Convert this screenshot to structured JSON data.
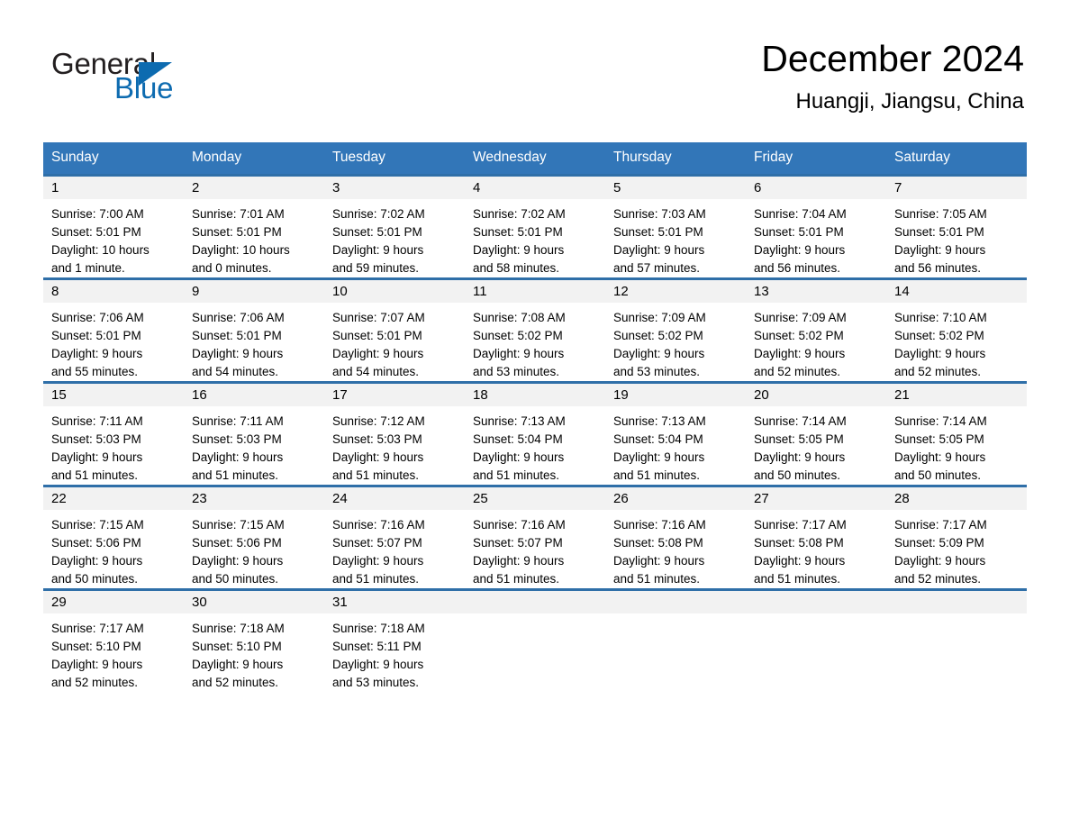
{
  "brand": {
    "name_part1": "General",
    "name_part2": "Blue",
    "triangle_color": "#0d6bb0"
  },
  "header": {
    "title": "December 2024",
    "location": "Huangji, Jiangsu, China"
  },
  "theme": {
    "header_blue": "#3276b8",
    "row_separator_blue": "#2f6fa8",
    "daynum_band_gray": "#f2f2f2"
  },
  "weekdays": [
    "Sunday",
    "Monday",
    "Tuesday",
    "Wednesday",
    "Thursday",
    "Friday",
    "Saturday"
  ],
  "weeks": [
    [
      {
        "day": "1",
        "sunrise": "Sunrise: 7:00 AM",
        "sunset": "Sunset: 5:01 PM",
        "daylight1": "Daylight: 10 hours",
        "daylight2": "and 1 minute."
      },
      {
        "day": "2",
        "sunrise": "Sunrise: 7:01 AM",
        "sunset": "Sunset: 5:01 PM",
        "daylight1": "Daylight: 10 hours",
        "daylight2": "and 0 minutes."
      },
      {
        "day": "3",
        "sunrise": "Sunrise: 7:02 AM",
        "sunset": "Sunset: 5:01 PM",
        "daylight1": "Daylight: 9 hours",
        "daylight2": "and 59 minutes."
      },
      {
        "day": "4",
        "sunrise": "Sunrise: 7:02 AM",
        "sunset": "Sunset: 5:01 PM",
        "daylight1": "Daylight: 9 hours",
        "daylight2": "and 58 minutes."
      },
      {
        "day": "5",
        "sunrise": "Sunrise: 7:03 AM",
        "sunset": "Sunset: 5:01 PM",
        "daylight1": "Daylight: 9 hours",
        "daylight2": "and 57 minutes."
      },
      {
        "day": "6",
        "sunrise": "Sunrise: 7:04 AM",
        "sunset": "Sunset: 5:01 PM",
        "daylight1": "Daylight: 9 hours",
        "daylight2": "and 56 minutes."
      },
      {
        "day": "7",
        "sunrise": "Sunrise: 7:05 AM",
        "sunset": "Sunset: 5:01 PM",
        "daylight1": "Daylight: 9 hours",
        "daylight2": "and 56 minutes."
      }
    ],
    [
      {
        "day": "8",
        "sunrise": "Sunrise: 7:06 AM",
        "sunset": "Sunset: 5:01 PM",
        "daylight1": "Daylight: 9 hours",
        "daylight2": "and 55 minutes."
      },
      {
        "day": "9",
        "sunrise": "Sunrise: 7:06 AM",
        "sunset": "Sunset: 5:01 PM",
        "daylight1": "Daylight: 9 hours",
        "daylight2": "and 54 minutes."
      },
      {
        "day": "10",
        "sunrise": "Sunrise: 7:07 AM",
        "sunset": "Sunset: 5:01 PM",
        "daylight1": "Daylight: 9 hours",
        "daylight2": "and 54 minutes."
      },
      {
        "day": "11",
        "sunrise": "Sunrise: 7:08 AM",
        "sunset": "Sunset: 5:02 PM",
        "daylight1": "Daylight: 9 hours",
        "daylight2": "and 53 minutes."
      },
      {
        "day": "12",
        "sunrise": "Sunrise: 7:09 AM",
        "sunset": "Sunset: 5:02 PM",
        "daylight1": "Daylight: 9 hours",
        "daylight2": "and 53 minutes."
      },
      {
        "day": "13",
        "sunrise": "Sunrise: 7:09 AM",
        "sunset": "Sunset: 5:02 PM",
        "daylight1": "Daylight: 9 hours",
        "daylight2": "and 52 minutes."
      },
      {
        "day": "14",
        "sunrise": "Sunrise: 7:10 AM",
        "sunset": "Sunset: 5:02 PM",
        "daylight1": "Daylight: 9 hours",
        "daylight2": "and 52 minutes."
      }
    ],
    [
      {
        "day": "15",
        "sunrise": "Sunrise: 7:11 AM",
        "sunset": "Sunset: 5:03 PM",
        "daylight1": "Daylight: 9 hours",
        "daylight2": "and 51 minutes."
      },
      {
        "day": "16",
        "sunrise": "Sunrise: 7:11 AM",
        "sunset": "Sunset: 5:03 PM",
        "daylight1": "Daylight: 9 hours",
        "daylight2": "and 51 minutes."
      },
      {
        "day": "17",
        "sunrise": "Sunrise: 7:12 AM",
        "sunset": "Sunset: 5:03 PM",
        "daylight1": "Daylight: 9 hours",
        "daylight2": "and 51 minutes."
      },
      {
        "day": "18",
        "sunrise": "Sunrise: 7:13 AM",
        "sunset": "Sunset: 5:04 PM",
        "daylight1": "Daylight: 9 hours",
        "daylight2": "and 51 minutes."
      },
      {
        "day": "19",
        "sunrise": "Sunrise: 7:13 AM",
        "sunset": "Sunset: 5:04 PM",
        "daylight1": "Daylight: 9 hours",
        "daylight2": "and 51 minutes."
      },
      {
        "day": "20",
        "sunrise": "Sunrise: 7:14 AM",
        "sunset": "Sunset: 5:05 PM",
        "daylight1": "Daylight: 9 hours",
        "daylight2": "and 50 minutes."
      },
      {
        "day": "21",
        "sunrise": "Sunrise: 7:14 AM",
        "sunset": "Sunset: 5:05 PM",
        "daylight1": "Daylight: 9 hours",
        "daylight2": "and 50 minutes."
      }
    ],
    [
      {
        "day": "22",
        "sunrise": "Sunrise: 7:15 AM",
        "sunset": "Sunset: 5:06 PM",
        "daylight1": "Daylight: 9 hours",
        "daylight2": "and 50 minutes."
      },
      {
        "day": "23",
        "sunrise": "Sunrise: 7:15 AM",
        "sunset": "Sunset: 5:06 PM",
        "daylight1": "Daylight: 9 hours",
        "daylight2": "and 50 minutes."
      },
      {
        "day": "24",
        "sunrise": "Sunrise: 7:16 AM",
        "sunset": "Sunset: 5:07 PM",
        "daylight1": "Daylight: 9 hours",
        "daylight2": "and 51 minutes."
      },
      {
        "day": "25",
        "sunrise": "Sunrise: 7:16 AM",
        "sunset": "Sunset: 5:07 PM",
        "daylight1": "Daylight: 9 hours",
        "daylight2": "and 51 minutes."
      },
      {
        "day": "26",
        "sunrise": "Sunrise: 7:16 AM",
        "sunset": "Sunset: 5:08 PM",
        "daylight1": "Daylight: 9 hours",
        "daylight2": "and 51 minutes."
      },
      {
        "day": "27",
        "sunrise": "Sunrise: 7:17 AM",
        "sunset": "Sunset: 5:08 PM",
        "daylight1": "Daylight: 9 hours",
        "daylight2": "and 51 minutes."
      },
      {
        "day": "28",
        "sunrise": "Sunrise: 7:17 AM",
        "sunset": "Sunset: 5:09 PM",
        "daylight1": "Daylight: 9 hours",
        "daylight2": "and 52 minutes."
      }
    ],
    [
      {
        "day": "29",
        "sunrise": "Sunrise: 7:17 AM",
        "sunset": "Sunset: 5:10 PM",
        "daylight1": "Daylight: 9 hours",
        "daylight2": "and 52 minutes."
      },
      {
        "day": "30",
        "sunrise": "Sunrise: 7:18 AM",
        "sunset": "Sunset: 5:10 PM",
        "daylight1": "Daylight: 9 hours",
        "daylight2": "and 52 minutes."
      },
      {
        "day": "31",
        "sunrise": "Sunrise: 7:18 AM",
        "sunset": "Sunset: 5:11 PM",
        "daylight1": "Daylight: 9 hours",
        "daylight2": "and 53 minutes."
      },
      {
        "day": "",
        "sunrise": "",
        "sunset": "",
        "daylight1": "",
        "daylight2": ""
      },
      {
        "day": "",
        "sunrise": "",
        "sunset": "",
        "daylight1": "",
        "daylight2": ""
      },
      {
        "day": "",
        "sunrise": "",
        "sunset": "",
        "daylight1": "",
        "daylight2": ""
      },
      {
        "day": "",
        "sunrise": "",
        "sunset": "",
        "daylight1": "",
        "daylight2": ""
      }
    ]
  ]
}
